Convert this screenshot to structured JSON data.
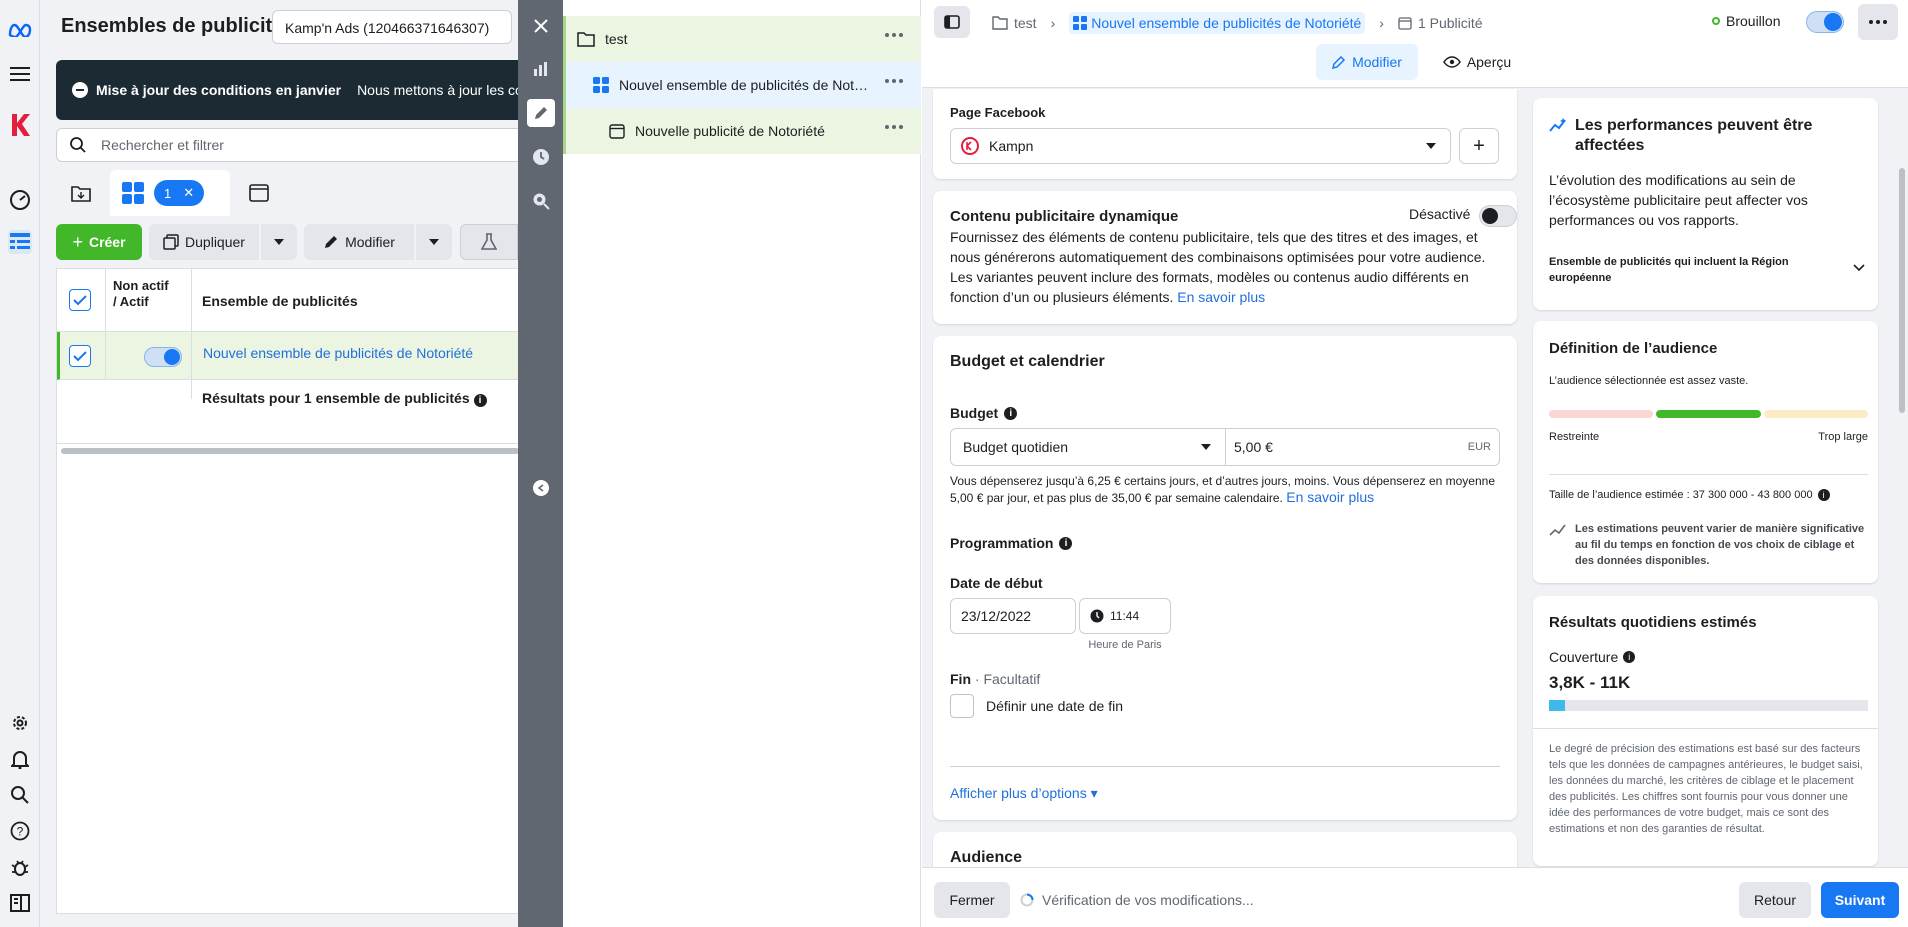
{
  "manager": {
    "title": "Ensembles de publicités",
    "account": "Kamp'n Ads (120466371646307)",
    "banner_title": "Mise à jour des conditions en janvier",
    "banner_text": "Nous mettons à jour les conditions",
    "search_placeholder": "Rechercher et filtrer",
    "selected_count": "1",
    "create": "Créer",
    "duplicate": "Dupliquer",
    "edit": "Modifier",
    "col_status": "Non actif / Actif",
    "col_name": "Ensemble de publicités",
    "row_name": "Nouvel ensemble de publicités de Notoriété",
    "results": "Résultats pour 1 ensemble de publicités"
  },
  "tree": {
    "campaign": "test",
    "adset": "Nouvel ensemble de publicités de Notoriété",
    "adset_short": "Nouvel ensemble de publicités de Not…",
    "ad": "Nouvelle publicité de Notoriété"
  },
  "editor": {
    "crumb_campaign": "test",
    "crumb_adset": "Nouvel ensemble de publicités de Notoriété",
    "crumb_ad": "1 Publicité",
    "status": "Brouillon",
    "tab_edit": "Modifier",
    "tab_preview": "Aperçu",
    "page_label": "Page Facebook",
    "page_value": "Kampn",
    "dynamic_title": "Contenu publicitaire dynamique",
    "dynamic_state": "Désactivé",
    "dynamic_text": "Fournissez des éléments de contenu publicitaire, tels que des titres et des images, et nous générerons automatiquement des combinaisons optimisées pour votre audience. Les variantes peuvent inclure des formats, modèles ou contenus audio différents en fonction d’un ou plusieurs éléments.",
    "learn_more": "En savoir plus",
    "budget_section": "Budget et calendrier",
    "budget_label": "Budget",
    "budget_type": "Budget quotidien",
    "budget_amount": "5,00 €",
    "currency": "EUR",
    "budget_note": "Vous dépenserez jusqu’à 6,25 € certains jours, et d’autres jours, moins. Vous dépenserez en moyenne 5,00 € par jour, et pas plus de 35,00 € par semaine calendaire.",
    "schedule_label": "Programmation",
    "start_label": "Date de début",
    "start_date": "23/12/2022",
    "start_time": "11:44",
    "timezone": "Heure de Paris",
    "end_label": "Fin",
    "end_optional": "· Facultatif",
    "end_checkbox": "Définir une date de fin",
    "more_options": "Afficher plus d’options ▾",
    "audience_section": "Audience",
    "close": "Fermer",
    "checking": "Vérification de vos modifications...",
    "back": "Retour",
    "next": "Suivant"
  },
  "side": {
    "perf_title": "Les performances peuvent être affectées",
    "perf_text": "L’évolution des modifications au sein de l’écosystème publicitaire peut affecter vos performances ou vos rapports.",
    "perf_item": "Ensemble de publicités qui incluent la Région européenne",
    "aud_title": "Définition de l’audience",
    "aud_text": "L’audience sélectionnée est assez vaste.",
    "aud_min": "Restreinte",
    "aud_max": "Trop large",
    "aud_size": "Taille de l’audience estimée : 37 300 000 - 43 800 000",
    "aud_note": "Les estimations peuvent varier de manière significative au fil du temps en fonction de vos choix de ciblage et des données disponibles.",
    "daily_title": "Résultats quotidiens estimés",
    "reach_label": "Couverture",
    "reach_value": "3,8K - 11K",
    "reach_fraction": 0.05,
    "disclaimer": "Le degré de précision des estimations est basé sur des facteurs tels que les données de campagnes antérieures, le budget saisi, les données du marché, les critères de ciblage et le placement des publicités. Les chiffres sont fournis pour vous donner une idée des performances de votre budget, mais ce sont des estimations et non des garanties de résultat."
  },
  "colors": {
    "brand": "#1877f2",
    "create_green": "#42b72a",
    "selected_row": "#ebf5e1",
    "dark_panel": "#606770"
  }
}
